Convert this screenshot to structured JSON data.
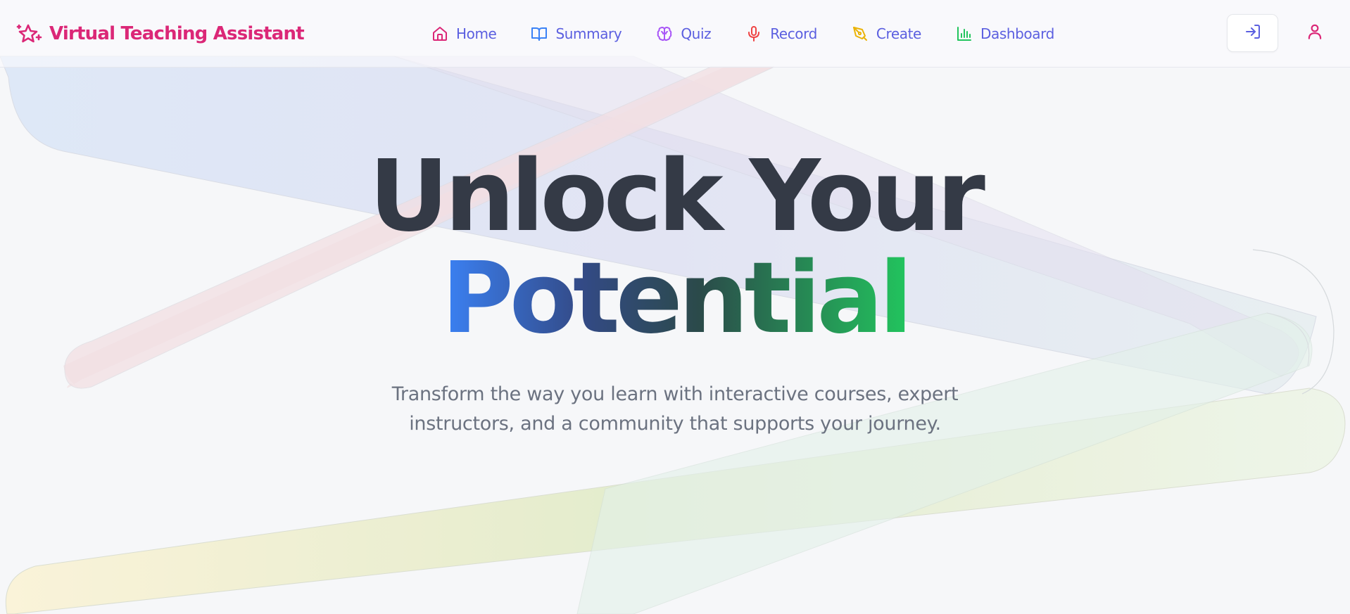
{
  "brand": {
    "name": "Virtual Teaching Assistant",
    "icon": "sparkles-icon",
    "color": "#db2777"
  },
  "nav": {
    "items": [
      {
        "label": "Home",
        "icon": "home-icon",
        "icon_color": "#db2777"
      },
      {
        "label": "Summary",
        "icon": "book-open-icon",
        "icon_color": "#3b82f6"
      },
      {
        "label": "Quiz",
        "icon": "brain-icon",
        "icon_color": "#a855f7"
      },
      {
        "label": "Record",
        "icon": "microphone-icon",
        "icon_color": "#ef4444"
      },
      {
        "label": "Create",
        "icon": "pen-tool-icon",
        "icon_color": "#eab308"
      },
      {
        "label": "Dashboard",
        "icon": "bar-chart-icon",
        "icon_color": "#22c55e"
      }
    ],
    "label_color": "#5b5fe0",
    "login_icon": "log-in-icon",
    "user_icon": "user-icon"
  },
  "hero": {
    "title_line1": "Unlock Your",
    "title_line2": "Potential",
    "subtitle": "Transform the way you learn with interactive courses, expert instructors, and a community that supports your journey."
  },
  "colors": {
    "title": "#343a46",
    "gradient_start": "#3b82f6",
    "gradient_end": "#22c55e",
    "subtitle": "#6b7280",
    "background": "#f6f7f9"
  }
}
